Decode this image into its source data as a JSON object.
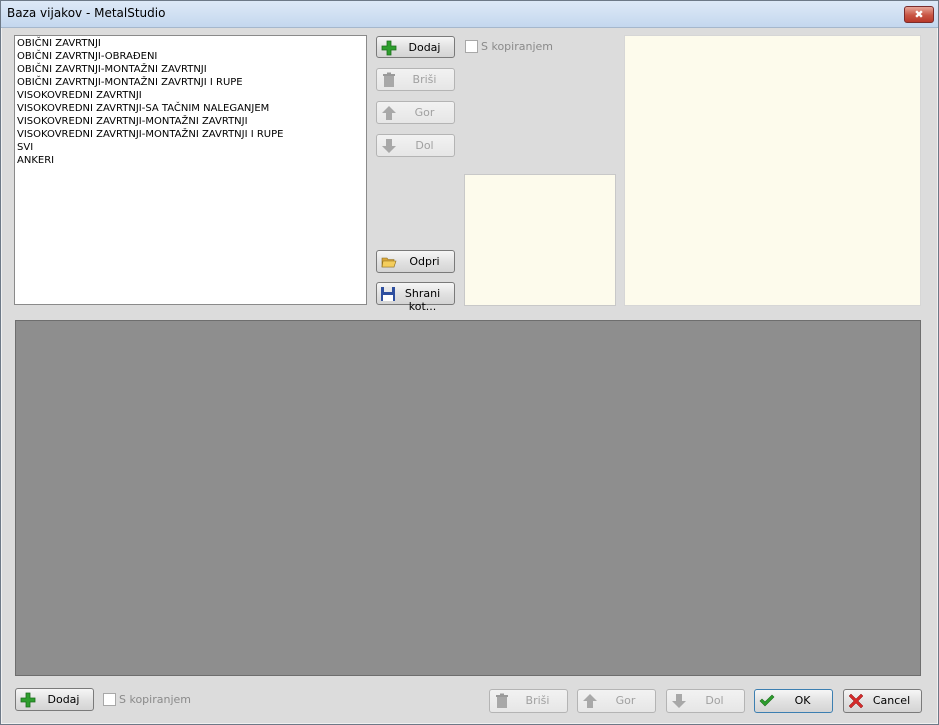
{
  "window": {
    "title": "Baza vijakov - MetalStudio",
    "close_glyph": "✖"
  },
  "list": {
    "items": [
      "OBIČNI ZAVRTNJI",
      "OBIČNI ZAVRTNJI-OBRAĐENI",
      "OBIČNI ZAVRTNJI-MONTAŽNI ZAVRTNJI",
      "OBIČNI ZAVRTNJI-MONTAŽNI ZAVRTNJI I RUPE",
      "VISOKOVREDNI ZAVRTNJI",
      "VISOKOVREDNI ZAVRTNJI-SA TAČNIM NALEGANJEM",
      "VISOKOVREDNI ZAVRTNJI-MONTAŽNI ZAVRTNJI",
      "VISOKOVREDNI ZAVRTNJI-MONTAŽNI ZAVRTNJI I RUPE",
      "SVI",
      "ANKERI"
    ]
  },
  "top_buttons": {
    "add": "Dodaj",
    "delete": "Briši",
    "up": "Gor",
    "down": "Dol",
    "open": "Odpri",
    "save_as": "Shrani kot..."
  },
  "top_copy_checkbox": {
    "label": "S kopiranjem",
    "checked": false
  },
  "bottom_buttons": {
    "add": "Dodaj",
    "delete": "Briši",
    "up": "Gor",
    "down": "Dol",
    "ok": "OK",
    "cancel": "Cancel"
  },
  "bottom_copy_checkbox": {
    "label": "S kopiranjem",
    "checked": false
  },
  "icons": {
    "add": "plus-icon",
    "delete": "trash-icon",
    "up": "arrow-up-icon",
    "down": "arrow-down-icon",
    "open": "folder-open-icon",
    "save": "floppy-disk-icon",
    "ok": "checkmark-icon",
    "cancel": "cross-icon"
  },
  "colors": {
    "preview_background": "#fdfbec",
    "canvas_background": "#8e8e8e",
    "add_icon": "#2e9e2e",
    "cancel_icon": "#d42a2a"
  }
}
